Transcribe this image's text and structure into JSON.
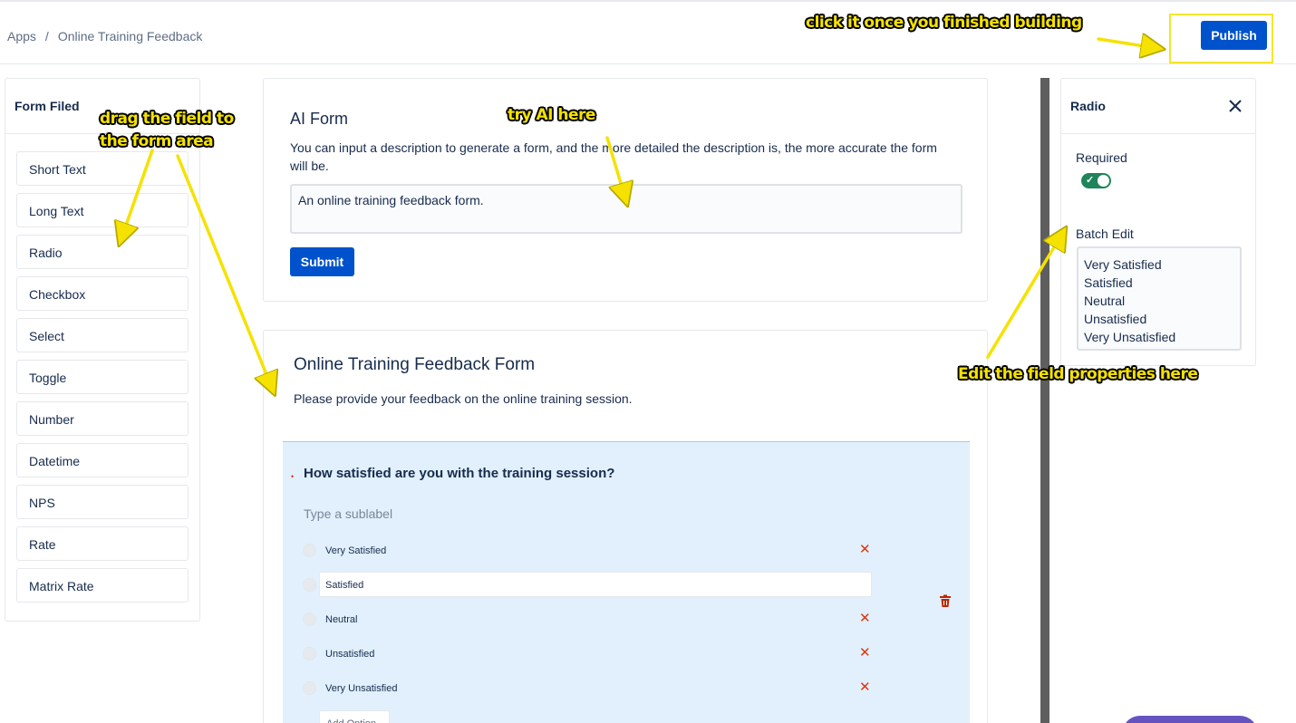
{
  "breadcrumb": {
    "root": "Apps",
    "separator": "/",
    "current": "Online Training Feedback"
  },
  "header": {
    "publish_label": "Publish"
  },
  "left_panel": {
    "title": "Form Filed",
    "fields": [
      "Short Text",
      "Long Text",
      "Radio",
      "Checkbox",
      "Select",
      "Toggle",
      "Number",
      "Datetime",
      "NPS",
      "Rate",
      "Matrix Rate"
    ]
  },
  "ai_form": {
    "title": "AI Form",
    "description": "You can input a description to generate a form, and the more detailed the description is, the more accurate the form will be.",
    "input_value": "An online training feedback form.",
    "submit_label": "Submit"
  },
  "form": {
    "title": "Online Training Feedback Form",
    "description": "Please provide your feedback on the online training session.",
    "field": {
      "required_marker": "•",
      "question": "How satisfied are you with the training session?",
      "sublabel_placeholder": "Type a sublabel",
      "options": [
        "Very Satisfied",
        "Satisfied",
        "Neutral",
        "Unsatisfied",
        "Very Unsatisfied"
      ],
      "add_option_label": "Add Option"
    }
  },
  "properties": {
    "title": "Radio",
    "required_label": "Required",
    "required": true,
    "batch_edit_label": "Batch Edit",
    "batch_edit_lines": [
      "Very Satisfied",
      "Satisfied",
      "Neutral",
      "Unsatisfied",
      "Very Unsatisfied"
    ]
  },
  "annotations": {
    "publish_hint": "click it once you finished building",
    "drag_hint_line1": "drag the field to",
    "drag_hint_line2": "the form area",
    "ai_hint": "try AI here",
    "edit_hint": "Edit the field properties here"
  },
  "colors": {
    "primary": "#0052cc",
    "annotation": "#f5e200",
    "toggle_on": "#1f845a",
    "field_highlight": "#e1f0fc",
    "danger": "#de350b"
  }
}
